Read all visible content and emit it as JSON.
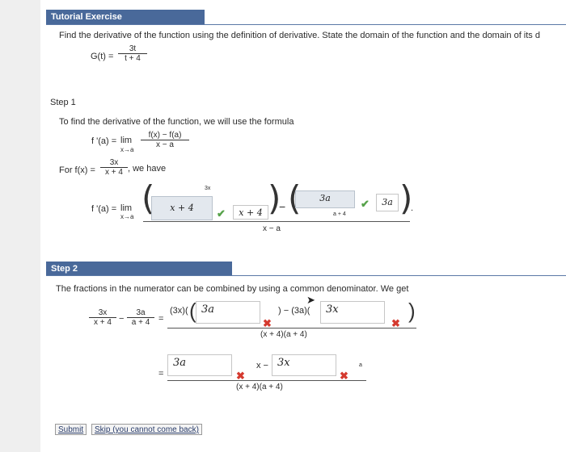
{
  "header": {
    "title": "Tutorial Exercise"
  },
  "problem": {
    "instruction": "Find the derivative of the function using the definition of derivative. State the domain of the function and the domain of its d",
    "func_lhs": "G(t) =",
    "func_num": "3t",
    "func_den": "t + 4"
  },
  "step1": {
    "label": "Step 1",
    "intro": "To find the derivative of the function, we will use the formula",
    "formula_lhs": "f '(a) =",
    "lim": "lim",
    "lim_sub": "x→a",
    "formula_num": "f(x) − f(a)",
    "formula_den": "x − a",
    "for_text": "For f(x) =",
    "f_num": "3x",
    "f_den": "x + 4",
    "we_have": ", we have",
    "answer_lhs": "f '(a) =",
    "box1_top": "3x",
    "box1_value": "x + 4",
    "box2_value": "x + 4",
    "minus": "−",
    "box3_value": "3a",
    "box3_sub": "a + 4",
    "box4_value": "3a",
    "denominator": "x − a",
    "period": "."
  },
  "step2": {
    "label": "Step 2",
    "intro": "The fractions in the numerator can be combined by using a common denominator. We get",
    "lhs1_num": "3x",
    "lhs1_den": "x + 4",
    "minus": "−",
    "lhs2_num": "3a",
    "lhs2_den": "a + 4",
    "eq": "=",
    "num_part1": "(3x)(",
    "box_a": "3a",
    "num_part2": ") − (3a)(",
    "box_b": "3x",
    "close_paren": ")",
    "common_den": "(x + 4)(a + 4)",
    "eq2": "=",
    "box_c": "3a",
    "x_minus": "x −",
    "box_d": "3x",
    "a_sup": "a",
    "common_den2": "(x + 4)(a + 4)"
  },
  "buttons": {
    "submit": "Submit",
    "skip": "Skip (you cannot come back)"
  },
  "marks": {
    "check": "✔",
    "cross": "✖"
  }
}
